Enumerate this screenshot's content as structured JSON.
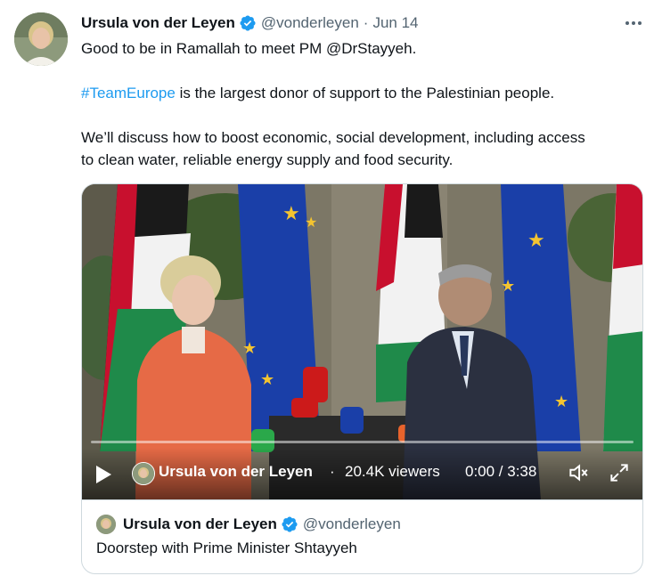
{
  "tweet": {
    "author_name": "Ursula von der Leyen",
    "handle": "@vonderleyen",
    "separator": "·",
    "date": "Jun 14",
    "lines": [
      "Good to be in Ramallah to meet PM @DrStayyeh.",
      "is the largest donor of support to the Palestinian people.",
      "We’ll discuss how to boost economic, social development, including access",
      "to clean water, reliable energy supply and food security."
    ],
    "hashtag": "#TeamEurope"
  },
  "video": {
    "author_name": "Ursula von der Leyen",
    "separator": "·",
    "viewers": "20.4K viewers",
    "time": "0:00 / 3:38"
  },
  "quoted_card": {
    "author_name": "Ursula von der Leyen",
    "handle": "@vonderleyen",
    "title": "Doorstep with Prime Minister Shtayyeh"
  },
  "colors": {
    "link": "#1d9bf0",
    "secondary_text": "#536471",
    "verified": "#1d9bf0"
  },
  "icons": {
    "more": "more-dots-icon",
    "verified": "verified-badge-icon",
    "play": "play-icon",
    "volume": "volume-icon",
    "fullscreen": "fullscreen-icon"
  }
}
